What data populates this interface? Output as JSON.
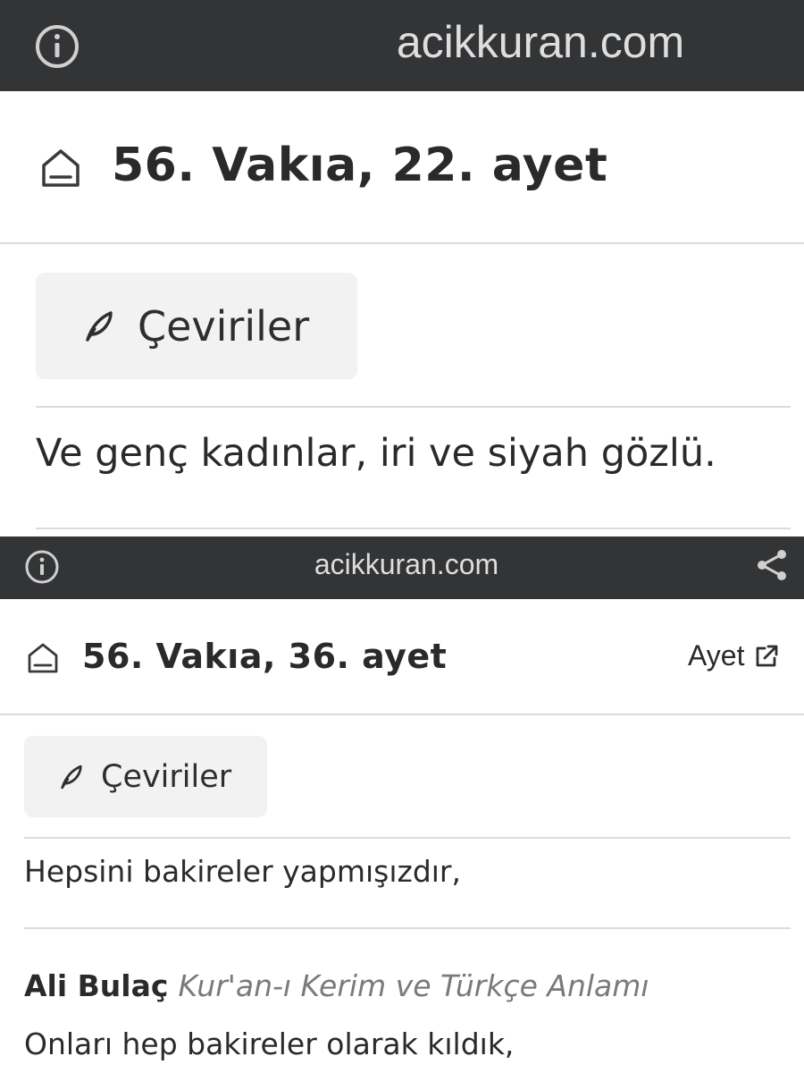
{
  "screen1": {
    "browser_bar": {
      "domain": "acikkuran.com",
      "info_icon": "info-circle-icon"
    },
    "header": {
      "title": "56. Vakıa, 22. ayet",
      "home_icon": "home-icon"
    },
    "translations_button": {
      "label": "Çeviriler",
      "icon": "feather-icon"
    },
    "verse_text": "Ve genç kadınlar, iri ve siyah gözlü."
  },
  "screen2": {
    "browser_bar": {
      "domain": "acikkuran.com",
      "info_icon": "info-circle-icon",
      "share_icon": "share-icon"
    },
    "header": {
      "title": "56. Vakıa, 36. ayet",
      "home_icon": "home-icon",
      "verse_link_label": "Ayet",
      "external_link_icon": "external-link-icon"
    },
    "translations_button": {
      "label": "Çeviriler",
      "icon": "feather-icon"
    },
    "verse_text": "Hepsini bakireler yapmışızdır,",
    "translation": {
      "author": "Ali Bulaç",
      "source": "Kur'an-ı Kerim ve Türkçe Anlamı",
      "text": "Onları hep bakireler olarak kıldık,"
    }
  },
  "colors": {
    "bar_bg": "#333436",
    "bar_text": "#dedede",
    "button_bg": "#f2f2f2",
    "divider": "#dcdcdc",
    "text": "#2a2a2a",
    "source_text": "#7a7a7a"
  }
}
